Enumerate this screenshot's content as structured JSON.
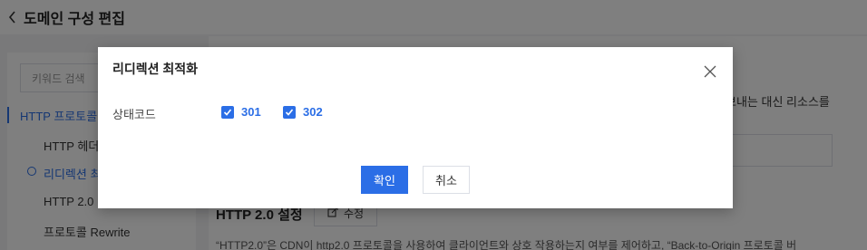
{
  "header": {
    "title": "도메인 구성 편집"
  },
  "sidebar": {
    "search_placeholder": "키워드 검색",
    "group_label": "HTTP 프로토콜",
    "items": [
      {
        "label": "HTTP 헤더"
      },
      {
        "label": "리디렉션 최"
      },
      {
        "label": "HTTP 2.0"
      },
      {
        "label": "프로토콜 Rewrite"
      }
    ]
  },
  "content": {
    "text_fragment": "보내는 대신 리소스를",
    "section_title": "HTTP 2.0 설정",
    "edit_label": "수정",
    "description": "“HTTP2.0”은 CDN이 http2.0 프로토콜을 사용하여 클라이언트와 상호 작용하는지 여부를 제어하고, “Back-to-Origin 프로토콜 버"
  },
  "dialog": {
    "title": "리디렉션 최적화",
    "field_label": "상태코드",
    "options": [
      {
        "label": "301",
        "checked": true
      },
      {
        "label": "302",
        "checked": true
      }
    ],
    "confirm_label": "확인",
    "cancel_label": "취소"
  },
  "colors": {
    "accent": "#2b6ee6",
    "mask": "rgba(0,0,0,0.5)"
  }
}
